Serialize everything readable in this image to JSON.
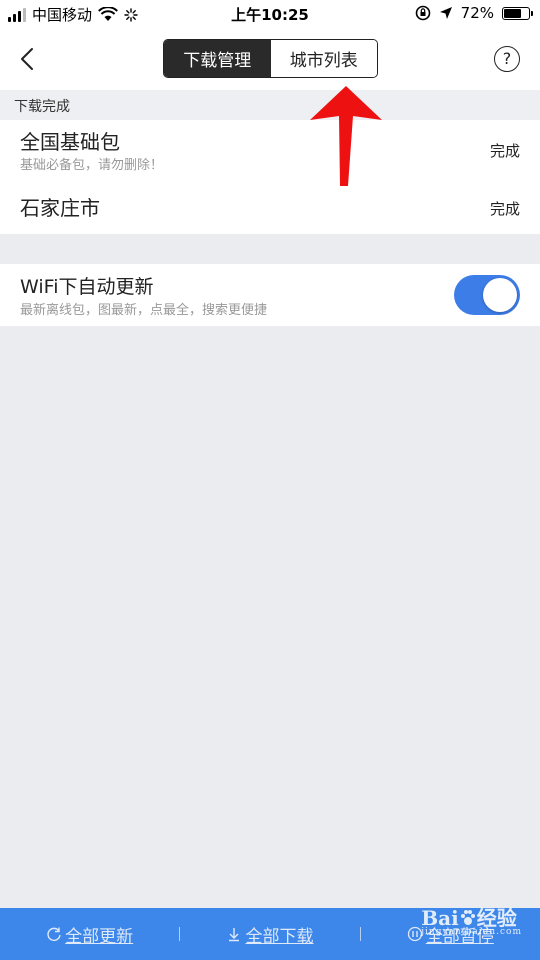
{
  "status_bar": {
    "carrier": "中国移动",
    "time": "上午10:25",
    "battery": "72%",
    "battery_level": 0.72
  },
  "nav": {
    "back_icon": "chevron-left-icon",
    "tabs": [
      {
        "label": "下载管理",
        "active": true
      },
      {
        "label": "城市列表",
        "active": false
      }
    ],
    "help_label": "?"
  },
  "downloaded": {
    "section_title": "下载完成",
    "items": [
      {
        "title": "全国基础包",
        "subtitle": "基础必备包，请勿删除！",
        "status": "完成"
      },
      {
        "title": "石家庄市",
        "status": "完成"
      }
    ]
  },
  "wifi_update": {
    "title": "WiFi下自动更新",
    "subtitle": "最新离线包，图最新，点最全，搜索更便捷",
    "enabled": true
  },
  "bottom_bar": {
    "update_all": "全部更新",
    "download_all": "全部下载",
    "pause_all": "全部暂停"
  },
  "watermark": {
    "text": "Bai",
    "suffix": "经验",
    "domain": "jingyan.baidu.com"
  },
  "colors": {
    "accent": "#3d7de8",
    "bottom_bar": "#3d86ea",
    "annotation_arrow": "#ee1111"
  }
}
